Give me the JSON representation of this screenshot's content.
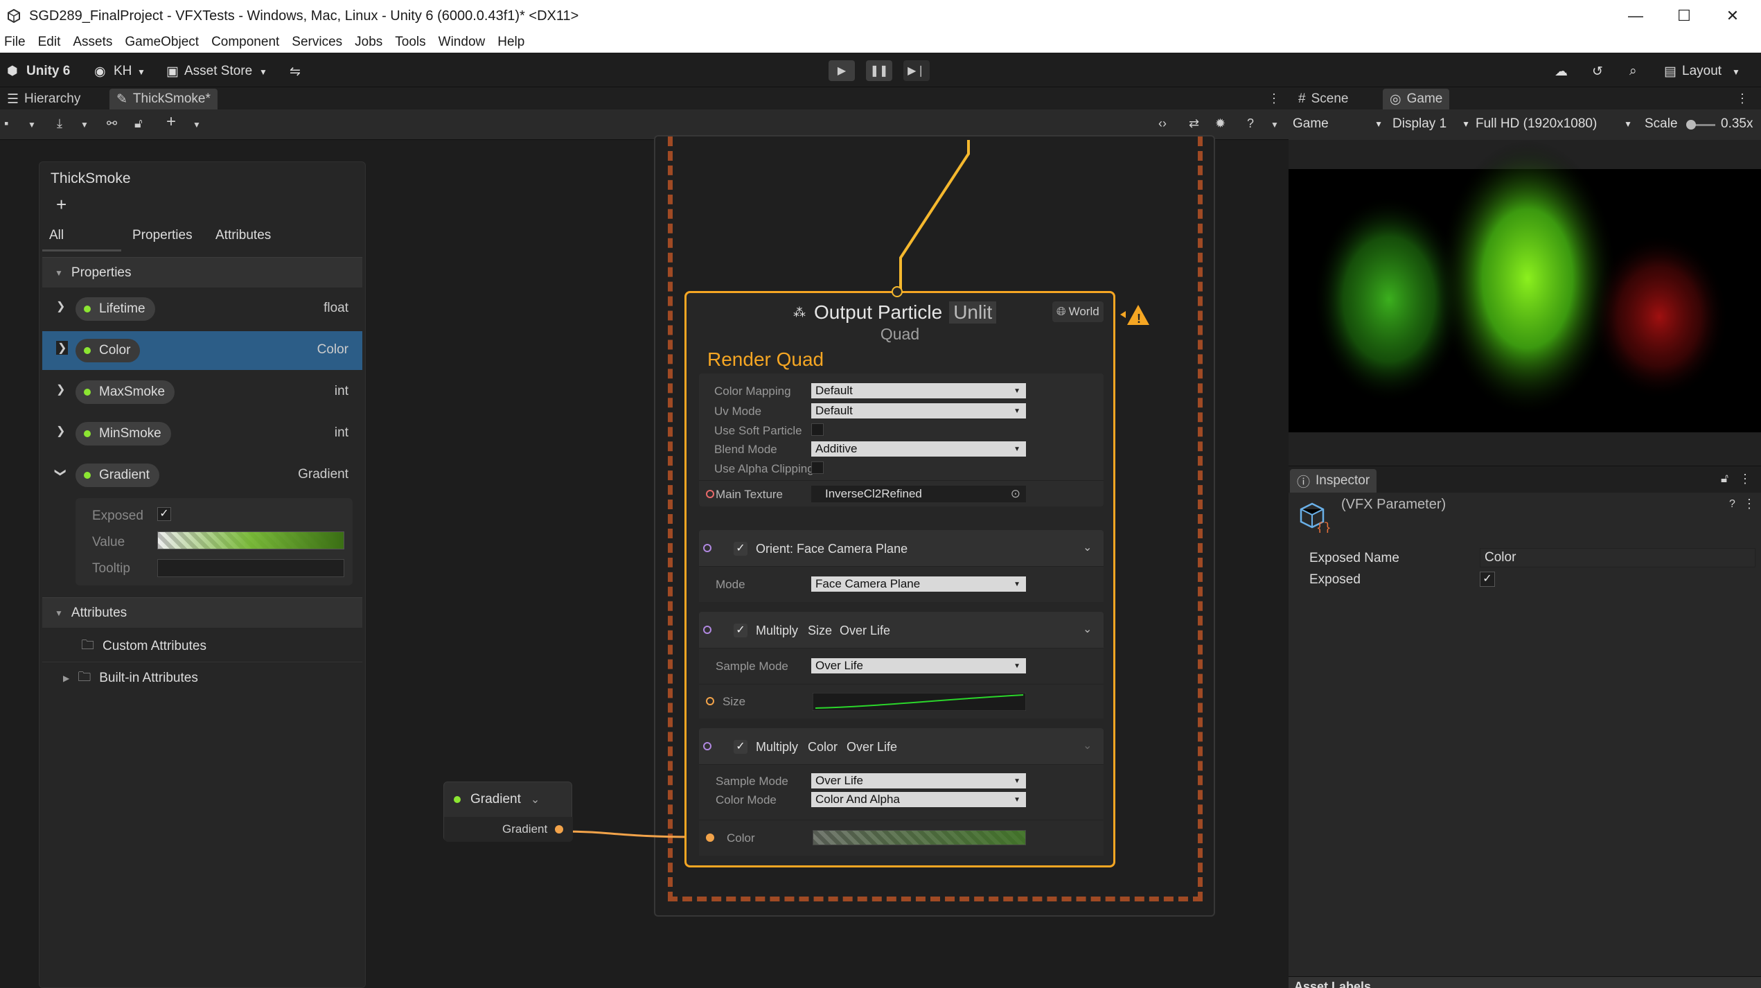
{
  "window": {
    "title": "SGD289_FinalProject - VFXTests - Windows, Mac, Linux - Unity 6 (6000.0.43f1)* <DX11>"
  },
  "menu": [
    "File",
    "Edit",
    "Assets",
    "GameObject",
    "Component",
    "Services",
    "Jobs",
    "Tools",
    "Window",
    "Help"
  ],
  "toolbar": {
    "brand": "Unity 6",
    "account": "KH",
    "asset_store": "Asset Store",
    "layout": "Layout"
  },
  "tabs": {
    "hierarchy": "Hierarchy",
    "graph": "ThickSmoke*",
    "scene": "Scene",
    "game": "Game"
  },
  "game_toolbar": {
    "view": "Game",
    "display": "Display 1",
    "resolution": "Full HD (1920x1080)",
    "scale_label": "Scale",
    "scale_value": "0.35x"
  },
  "blackboard": {
    "title": "ThickSmoke",
    "add": "+",
    "tabs": [
      "All",
      "Properties",
      "Attributes"
    ],
    "properties_header": "Properties",
    "properties": [
      {
        "name": "Lifetime",
        "type": "float"
      },
      {
        "name": "Color",
        "type": "Color"
      },
      {
        "name": "MaxSmoke",
        "type": "int"
      },
      {
        "name": "MinSmoke",
        "type": "int"
      },
      {
        "name": "Gradient",
        "type": "Gradient"
      }
    ],
    "gradient_fields": {
      "exposed": "Exposed",
      "value": "Value",
      "tooltip": "Tooltip"
    },
    "attributes_header": "Attributes",
    "custom_attributes": "Custom Attributes",
    "builtin_attributes": "Built-in Attributes"
  },
  "output": {
    "title": "Output Particle",
    "unlit": "Unlit",
    "subtitle": "Quad",
    "space": "World",
    "render_label": "Render Quad",
    "fields": [
      {
        "label": "Color Mapping",
        "value": "Default"
      },
      {
        "label": "Uv Mode",
        "value": "Default"
      },
      {
        "label": "Use Soft Particle",
        "value": ""
      },
      {
        "label": "Blend Mode",
        "value": "Additive"
      },
      {
        "label": "Use Alpha Clipping",
        "value": ""
      }
    ],
    "main_texture_label": "Main Texture",
    "main_texture_value": "InverseCl2Refined",
    "orient": {
      "title": "Orient: Face Camera Plane",
      "mode_label": "Mode",
      "mode_value": "Face Camera Plane"
    },
    "size_block": {
      "w1": "Multiply",
      "w2": "Size",
      "w3": "Over Life",
      "sample_label": "Sample Mode",
      "sample_value": "Over Life",
      "size_label": "Size"
    },
    "color_block": {
      "w1": "Multiply",
      "w2": "Color",
      "w3": "Over Life",
      "sample_label": "Sample Mode",
      "sample_value": "Over Life",
      "mode_label": "Color Mode",
      "mode_value": "Color And Alpha",
      "color_label": "Color"
    }
  },
  "gradient_node": {
    "title": "Gradient",
    "port": "Gradient"
  },
  "inspector": {
    "tab": "Inspector",
    "object": "(VFX Parameter)",
    "exposed_name_label": "Exposed Name",
    "exposed_name_value": "Color",
    "exposed_label": "Exposed",
    "footer": "Asset Labels"
  },
  "colors": {
    "accent_orange": "#f5a623",
    "dashed": "#a04a24",
    "selection": "#2c5d87",
    "property_dot": "#8ce632"
  }
}
